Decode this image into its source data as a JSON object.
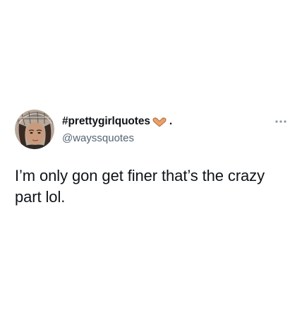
{
  "tweet": {
    "author": {
      "display_name": "#prettygirlquotes",
      "name_emoji": "heart-hands-icon",
      "name_suffix": ".",
      "handle": "@wayssquotes"
    },
    "more_icon": "more-horizontal-icon",
    "text": "I’m only gon get finer that’s the crazy part lol."
  },
  "colors": {
    "text_primary": "#0f1419",
    "text_secondary": "#536471",
    "background": "#ffffff",
    "icon_gray": "#8b98a5"
  }
}
